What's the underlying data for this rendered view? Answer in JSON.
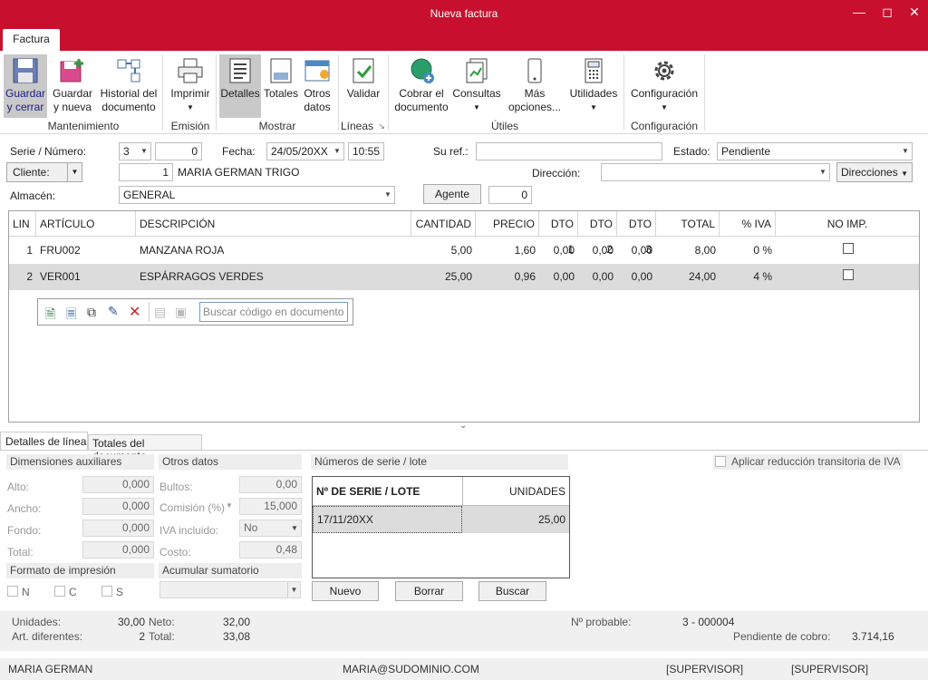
{
  "window": {
    "title": "Nueva factura"
  },
  "ribbon": {
    "tab": "Factura",
    "buttons": {
      "guardar_cerrar": "Guardar\ny cerrar",
      "guardar_nueva": "Guardar\ny nueva",
      "historial": "Historial del\ndocumento",
      "imprimir": "Imprimir",
      "detalles": "Detalles",
      "totales": "Totales",
      "otros_datos": "Otros\ndatos",
      "validar": "Validar",
      "cobrar": "Cobrar el\ndocumento",
      "consultas": "Consultas",
      "mas_opciones": "Más\nopciones...",
      "utilidades": "Utilidades",
      "configuracion": "Configuración"
    },
    "groups": {
      "mantenimiento": "Mantenimiento",
      "emision": "Emisión",
      "mostrar": "Mostrar",
      "lineas": "Líneas",
      "utiles": "Útiles",
      "configuracion": "Configuración"
    }
  },
  "form": {
    "serie_label": "Serie / Número:",
    "serie": "3",
    "numero": "0",
    "fecha_label": "Fecha:",
    "fecha": "24/05/20XX",
    "hora": "10:55",
    "suref_label": "Su ref.:",
    "suref": "",
    "estado_label": "Estado:",
    "estado": "Pendiente",
    "cliente_label": "Cliente:",
    "cliente_codigo": "1",
    "cliente_nombre": "MARIA GERMAN TRIGO",
    "direccion_label": "Dirección:",
    "direccion": "",
    "direcciones_button": "Direcciones",
    "almacen_label": "Almacén:",
    "almacen": "GENERAL",
    "agente_button": "Agente",
    "agente": "0"
  },
  "grid": {
    "columns": [
      "LIN",
      "ARTÍCULO",
      "DESCRIPCIÓN",
      "CANTIDAD",
      "PRECIO",
      "DTO 1",
      "DTO 2",
      "DTO 3",
      "TOTAL",
      "% IVA",
      "NO IMP."
    ],
    "rows": [
      {
        "lin": "1",
        "articulo": "FRU002",
        "descripcion": "MANZANA ROJA",
        "cantidad": "5,00",
        "precio": "1,60",
        "dto1": "0,00",
        "dto2": "0,00",
        "dto3": "0,00",
        "total": "8,00",
        "iva": "0 %"
      },
      {
        "lin": "2",
        "articulo": "VER001",
        "descripcion": "ESPÁRRAGOS VERDES",
        "cantidad": "25,00",
        "precio": "0,96",
        "dto1": "0,00",
        "dto2": "0,00",
        "dto3": "0,00",
        "total": "24,00",
        "iva": "4 %"
      }
    ],
    "search_placeholder": "Buscar código en documento"
  },
  "detail_tabs": [
    "Detalles de línea",
    "Totales del documento"
  ],
  "detail": {
    "dimensiones_title": "Dimensiones auxiliares",
    "alto_label": "Alto:",
    "alto": "0,000",
    "ancho_label": "Ancho:",
    "ancho": "0,000",
    "fondo_label": "Fondo:",
    "fondo": "0,000",
    "total_label": "Total:",
    "total": "0,000",
    "otros_title": "Otros datos",
    "bultos_label": "Bultos:",
    "bultos": "0,00",
    "comision_label": "Comisión (%)",
    "comision": "15,000",
    "iva_incluido_label": "IVA incluido:",
    "iva_incluido": "No",
    "coste_label": "Costo:",
    "coste": "0,48",
    "formato_title": "Formato de impresión",
    "formato_n": "N",
    "formato_c": "C",
    "formato_s": "S",
    "acumular_title": "Acumular sumatorio",
    "series_title": "Números de serie / lote",
    "series_col1": "Nº DE SERIE / LOTE",
    "series_col2": "UNIDADES",
    "series_row_serie": "17/11/20XX",
    "series_row_unidades": "25,00",
    "nuevo_button": "Nuevo",
    "borrar_button": "Borrar",
    "buscar_button": "Buscar",
    "reduccion_label": "Aplicar reducción transitoria de IVA"
  },
  "summary": {
    "unidades_label": "Unidades:",
    "unidades": "30,00",
    "art_label": "Art. diferentes:",
    "art": "2",
    "neto_label": "Neto:",
    "neto": "32,00",
    "total_label": "Total:",
    "total": "33,08",
    "probable_label": "Nº probable:",
    "probable": "3 - 000004",
    "pendiente_label": "Pendiente de cobro:",
    "pendiente": "3.714,16"
  },
  "status": {
    "user": "MARIA GERMAN",
    "email": "MARIA@SUDOMINIO.COM",
    "role1": "[SUPERVISOR]",
    "role2": "[SUPERVISOR]"
  },
  "colors": {
    "accent": "#c8102e"
  }
}
